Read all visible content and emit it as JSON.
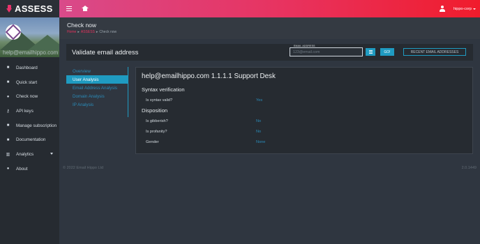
{
  "brand": {
    "name": "ASSESS",
    "accent": "#e8336b"
  },
  "profile": {
    "handle": "help@emailhippo.com"
  },
  "sidebar": {
    "items": [
      {
        "label": "Dashboard",
        "icon": "dashboard-icon"
      },
      {
        "label": "Quick start",
        "icon": "quick-start-icon"
      },
      {
        "label": "Check now",
        "icon": "check-icon"
      },
      {
        "label": "API keys",
        "icon": "key-icon"
      },
      {
        "label": "Manage subscription",
        "icon": "subscription-icon"
      },
      {
        "label": "Documentation",
        "icon": "document-icon"
      },
      {
        "label": "Analytics",
        "icon": "analytics-icon"
      },
      {
        "label": "About",
        "icon": "info-icon"
      }
    ]
  },
  "topbar": {
    "user": "hippo-corp",
    "gradient_start": "#d94a8a",
    "gradient_end": "#f01c2c"
  },
  "page": {
    "title": "Check now",
    "breadcrumb": [
      "Home",
      "ASSESS",
      "Check now"
    ]
  },
  "validate": {
    "title": "Validate email address",
    "email_label": "EMAIL ADDRESS",
    "email_placeholder": "123@email.com",
    "go_label": "GO!",
    "recent_label": "RECENT EMAIL ADDRESSES",
    "button_color": "#1f9bc1"
  },
  "subnav": {
    "items": [
      "Overview",
      "User Analysis",
      "Email Address Analysis",
      "Domain Analysis",
      "IP Analysis"
    ],
    "active": "User Analysis"
  },
  "results": {
    "title": "help@emailhippo.com 1.1.1.1 Support Desk",
    "syntax": {
      "heading": "Syntax verification",
      "rows": [
        {
          "label": "Is syntax valid?",
          "value": "Yes"
        }
      ]
    },
    "disposition": {
      "heading": "Disposition",
      "rows": [
        {
          "label": "Is gibberish?",
          "value": "No"
        },
        {
          "label": "Is profanity?",
          "value": "No"
        },
        {
          "label": "Gender",
          "value": "None"
        }
      ]
    }
  },
  "footer": {
    "copyright": "© 2022 Email Hippo Ltd",
    "version": "2.0.1449"
  }
}
